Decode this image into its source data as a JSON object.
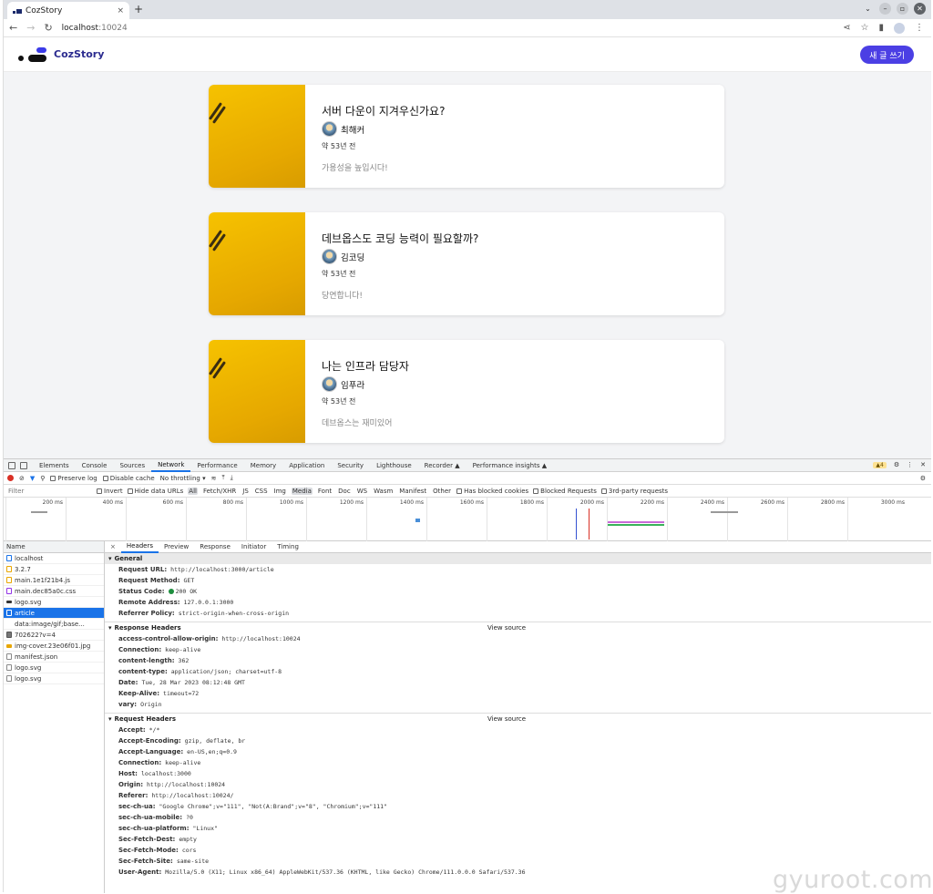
{
  "browser": {
    "tab_title": "CozStory",
    "tab_close": "×",
    "new_tab": "+",
    "url_host": "localhost",
    "url_port": ":10024"
  },
  "app": {
    "brand": "CozStory",
    "write_button": "새 글 쓰기"
  },
  "articles": [
    {
      "title": "서버 다운이 지겨우신가요?",
      "author": "최해커",
      "time": "약 53년 전",
      "summary": "가용성을 높입시다!"
    },
    {
      "title": "데브옵스도 코딩 능력이 필요할까?",
      "author": "김코딩",
      "time": "약 53년 전",
      "summary": "당연합니다!"
    },
    {
      "title": "나는 인프라 담당자",
      "author": "임푸라",
      "time": "약 53년 전",
      "summary": "데브옵스는 재미있어"
    }
  ],
  "devtools": {
    "tabs": [
      "Elements",
      "Console",
      "Sources",
      "Network",
      "Performance",
      "Memory",
      "Application",
      "Security",
      "Lighthouse",
      "Recorder ▲",
      "Performance insights ▲"
    ],
    "active_tab": "Network",
    "warnings": "▲4",
    "toolbar": {
      "preserve_log": "Preserve log",
      "disable_cache": "Disable cache",
      "throttling": "No throttling"
    },
    "filter": {
      "placeholder": "Filter",
      "invert": "Invert",
      "hide_data_urls": "Hide data URLs",
      "types": [
        "All",
        "Fetch/XHR",
        "JS",
        "CSS",
        "Img",
        "Media",
        "Font",
        "Doc",
        "WS",
        "Wasm",
        "Manifest",
        "Other"
      ],
      "has_blocked_cookies": "Has blocked cookies",
      "blocked_requests": "Blocked Requests",
      "third_party": "3rd-party requests"
    },
    "timeline_ticks": [
      "200 ms",
      "400 ms",
      "600 ms",
      "800 ms",
      "1000 ms",
      "1200 ms",
      "1400 ms",
      "1600 ms",
      "1800 ms",
      "2000 ms",
      "2200 ms",
      "2400 ms",
      "2600 ms",
      "2800 ms",
      "3000 ms"
    ],
    "name_header": "Name",
    "requests": [
      "localhost",
      "3.2.7",
      "main.1e1f21b4.js",
      "main.dec85a0c.css",
      "logo.svg",
      "article",
      "data:image/gif;base...",
      "702622?v=4",
      "img-cover.23e06f01.jpg",
      "manifest.json",
      "logo.svg",
      "logo.svg"
    ],
    "selected_request": "article",
    "detail_tabs": [
      "Headers",
      "Preview",
      "Response",
      "Initiator",
      "Timing"
    ],
    "general_title": "General",
    "general": [
      {
        "k": "Request URL:",
        "v": "http://localhost:3000/article"
      },
      {
        "k": "Request Method:",
        "v": "GET"
      },
      {
        "k": "Status Code:",
        "v": "200 OK"
      },
      {
        "k": "Remote Address:",
        "v": "127.0.0.1:3000"
      },
      {
        "k": "Referrer Policy:",
        "v": "strict-origin-when-cross-origin"
      }
    ],
    "response_title": "Response Headers",
    "view_source": "View source",
    "response": [
      {
        "k": "access-control-allow-origin:",
        "v": "http://localhost:10024"
      },
      {
        "k": "Connection:",
        "v": "keep-alive"
      },
      {
        "k": "content-length:",
        "v": "362"
      },
      {
        "k": "content-type:",
        "v": "application/json; charset=utf-8"
      },
      {
        "k": "Date:",
        "v": "Tue, 28 Mar 2023 08:12:48 GMT"
      },
      {
        "k": "Keep-Alive:",
        "v": "timeout=72"
      },
      {
        "k": "vary:",
        "v": "Origin"
      }
    ],
    "request_title": "Request Headers",
    "request": [
      {
        "k": "Accept:",
        "v": "*/*"
      },
      {
        "k": "Accept-Encoding:",
        "v": "gzip, deflate, br"
      },
      {
        "k": "Accept-Language:",
        "v": "en-US,en;q=0.9"
      },
      {
        "k": "Connection:",
        "v": "keep-alive"
      },
      {
        "k": "Host:",
        "v": "localhost:3000"
      },
      {
        "k": "Origin:",
        "v": "http://localhost:10024"
      },
      {
        "k": "Referer:",
        "v": "http://localhost:10024/"
      },
      {
        "k": "sec-ch-ua:",
        "v": "\"Google Chrome\";v=\"111\", \"Not(A:Brand\";v=\"8\", \"Chromium\";v=\"111\""
      },
      {
        "k": "sec-ch-ua-mobile:",
        "v": "?0"
      },
      {
        "k": "sec-ch-ua-platform:",
        "v": "\"Linux\""
      },
      {
        "k": "Sec-Fetch-Dest:",
        "v": "empty"
      },
      {
        "k": "Sec-Fetch-Mode:",
        "v": "cors"
      },
      {
        "k": "Sec-Fetch-Site:",
        "v": "same-site"
      },
      {
        "k": "User-Agent:",
        "v": "Mozilla/5.0 (X11; Linux x86_64) AppleWebKit/537.36 (KHTML, like Gecko) Chrome/111.0.0.0 Safari/537.36"
      }
    ]
  },
  "watermark": "gyuroot.com",
  "colors": {
    "accent": "#4b3fe4",
    "selected": "#1a73e8",
    "status_ok": "#1e8e3e"
  }
}
